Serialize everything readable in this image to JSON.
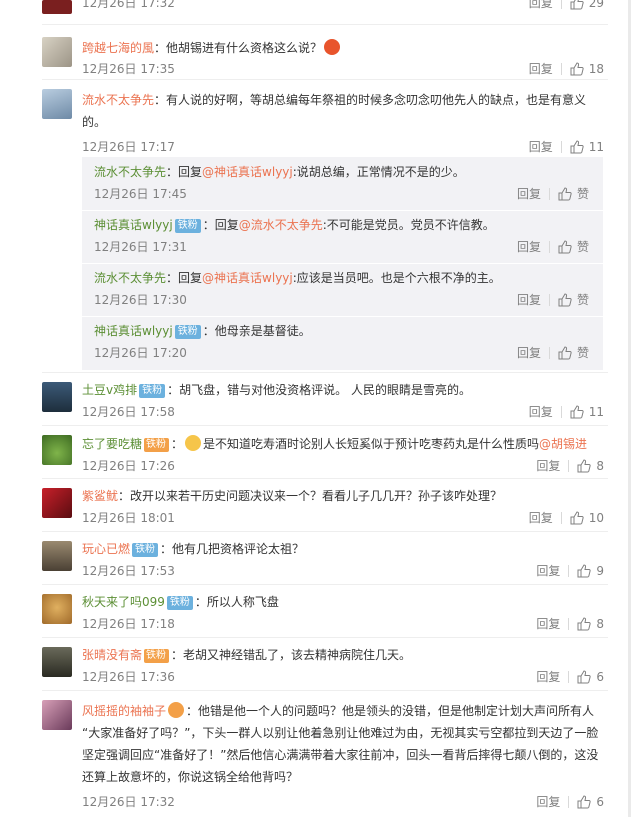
{
  "colors": {
    "username": "#eb7350",
    "badge_fan": "#6cb1de",
    "badge_vip": "#f3a048",
    "reply_bg": "#f2f2f5",
    "time": "#808080"
  },
  "labels": {
    "reply": "回复",
    "like": "赞",
    "colon": "：",
    "reply_prefix": "回复"
  },
  "top_partial": {
    "time": "12月26日 17:32",
    "likes": "29"
  },
  "comments": [
    {
      "user": "跨越七海的風",
      "text": "他胡锡进有什么资格这么说？",
      "time": "12月26日 17:35",
      "likes": "18"
    },
    {
      "user": "流水不太争先",
      "text": "有人说的好啊，等胡总编每年祭祖的时候多念叨念叨他先人的缺点，也是有意义的。",
      "time": "12月26日 17:17",
      "likes": "11"
    },
    {
      "user": "土豆v鸡排",
      "badge": "铁粉",
      "text": "胡飞盘，错与对他没资格评说。 人民的眼睛是雪亮的。",
      "time": "12月26日 17:58",
      "likes": "11"
    },
    {
      "user": "忘了要吃糖",
      "badge": "铁粉",
      "text": "是不知道吃寿酒时论别人长短奚似于预计吃枣药丸是什么性质吗",
      "mention": "@胡锡进",
      "time": "12月26日 17:26",
      "likes": "8"
    },
    {
      "user": "紫鲨鱿",
      "text": "改开以来若干历史问题决议来一个？看看儿子几几开？孙子该咋处理？",
      "time": "12月26日 18:01",
      "likes": "10"
    },
    {
      "user": "玩心已燃",
      "badge": "铁粉",
      "text": "他有几把资格评论太祖？",
      "time": "12月26日 17:53",
      "likes": "9"
    },
    {
      "user": "秋天来了吗099",
      "badge": "铁粉",
      "text": "所以人称飞盘",
      "time": "12月26日 17:18",
      "likes": "8"
    },
    {
      "user": "张晴没有斋",
      "badge": "铁粉",
      "text": "老胡又神经错乱了，该去精神病院住几天。",
      "time": "12月26日 17:36",
      "likes": "6"
    },
    {
      "user": "风摇摇的袖袖子",
      "text_lines": [
        "他错是他一个人的问题吗？他是领头的没错，但是他制定计划大声问所有人",
        "“大家准备好了吗？”，下头一群人以别让他着急别让他难过为由，无视其实亏空都拉到天边了一脸",
        "坚定强调回应“准备好了！”然后他信心满满带着大家往前冲，回头一看背后摔得七颠八倒的，这没",
        "还算上故意坏的，你说这锅全给他背吗？"
      ],
      "time": "12月26日 17:32",
      "likes": "6"
    }
  ],
  "subreplies": [
    {
      "user": "流水不太争先",
      "target": "@神话真话wlyyj",
      "text": ":说胡总编，正常情况不是的少。",
      "time": "12月26日 17:45"
    },
    {
      "user": "神话真话wlyyj",
      "badge": "铁粉",
      "target": "@流水不太争先",
      "text": ":不可能是党员。党员不许信教。",
      "time": "12月26日 17:31"
    },
    {
      "user": "流水不太争先",
      "target": "@神话真话wlyyj",
      "text": ":应该是当员吧。也是个六根不净的主。",
      "time": "12月26日 17:30"
    },
    {
      "user": "神话真话wlyyj",
      "badge": "铁粉",
      "text": "他母亲是基督徒。",
      "time": "12月26日 17:20"
    }
  ]
}
